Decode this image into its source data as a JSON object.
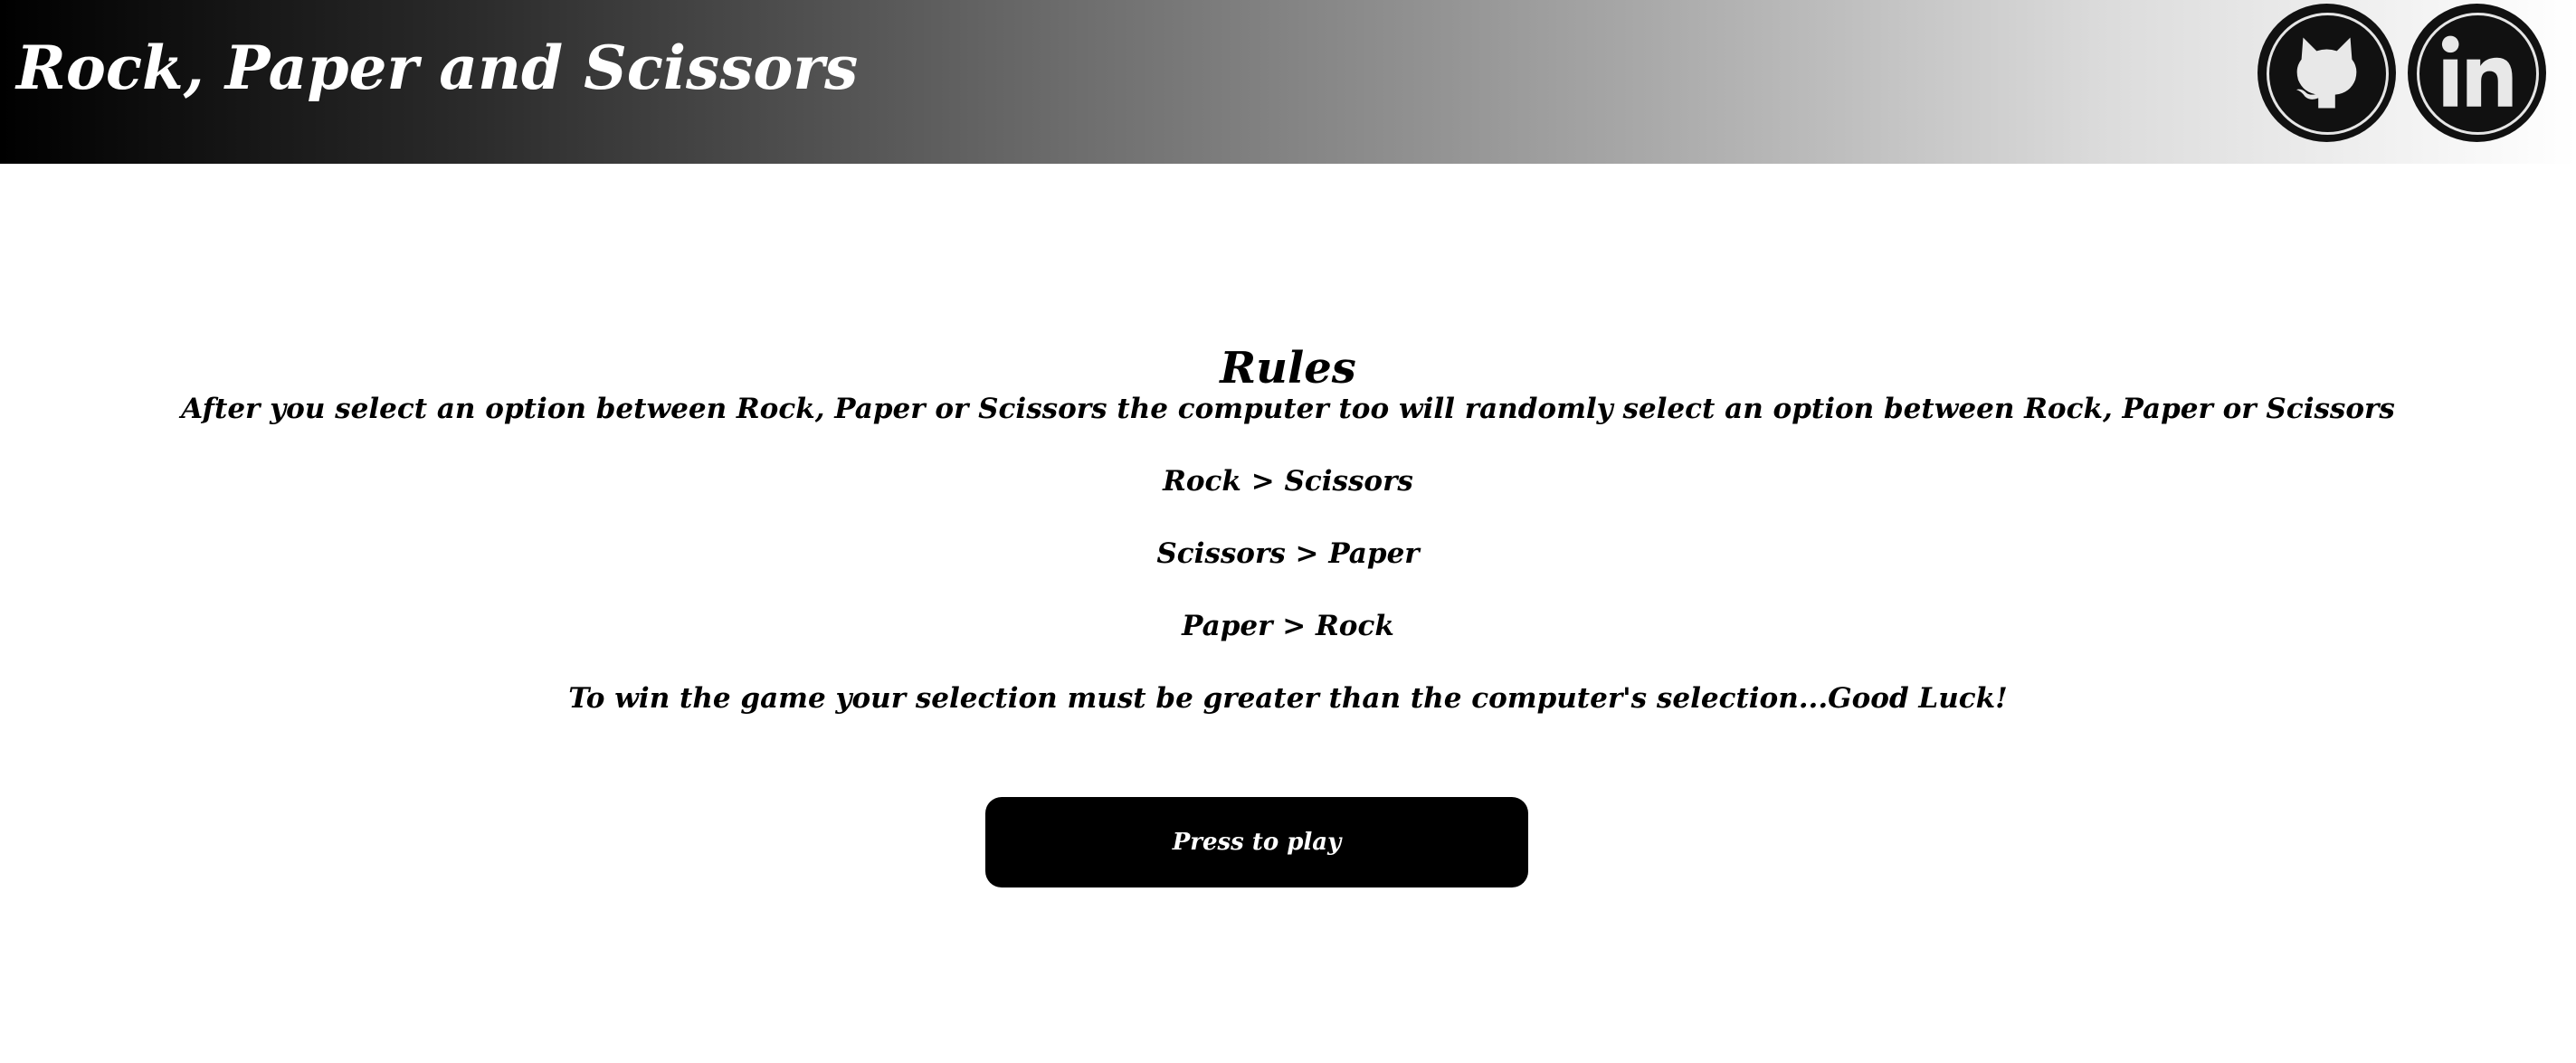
{
  "header": {
    "title": "Rock, Paper and Scissors",
    "links": [
      {
        "icon": "github-icon",
        "label": "GitHub"
      },
      {
        "icon": "linkedin-icon",
        "label": "LinkedIn"
      }
    ],
    "gradient_start": "#000000",
    "gradient_end": "#ffffff"
  },
  "rules": {
    "title": "Rules",
    "intro": "After you select an option between Rock, Paper or Scissors the computer too will randomly select an option between Rock, Paper or Scissors",
    "rule1": "Rock > Scissors",
    "rule2": "Scissors > Paper",
    "rule3": "Paper > Rock",
    "closing": "To win the game your selection must be greater than the computer's selection...Good Luck!"
  },
  "play_button": {
    "label": "Press to play",
    "background": "#000000",
    "text_color": "#ffffff"
  }
}
